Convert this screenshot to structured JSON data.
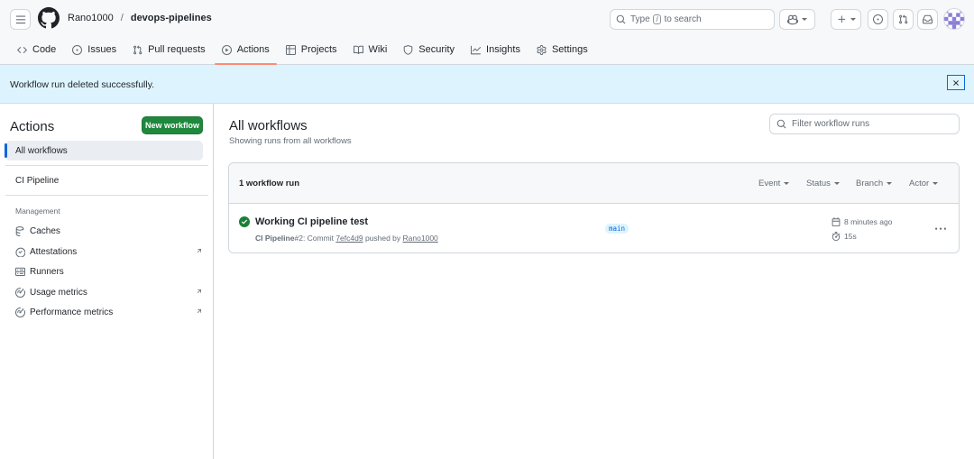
{
  "header": {
    "owner": "Rano1000",
    "separator": "/",
    "repo": "devops-pipelines",
    "search": {
      "prefix": "Type",
      "key": "/",
      "suffix": "to search"
    }
  },
  "tabs": [
    {
      "label": "Code",
      "icon": "code-icon"
    },
    {
      "label": "Issues",
      "icon": "issue-opened-icon"
    },
    {
      "label": "Pull requests",
      "icon": "git-pull-request-icon"
    },
    {
      "label": "Actions",
      "icon": "play-icon",
      "active": true
    },
    {
      "label": "Projects",
      "icon": "table-icon"
    },
    {
      "label": "Wiki",
      "icon": "book-icon"
    },
    {
      "label": "Security",
      "icon": "shield-icon"
    },
    {
      "label": "Insights",
      "icon": "graph-icon"
    },
    {
      "label": "Settings",
      "icon": "gear-icon"
    }
  ],
  "flash": {
    "message": "Workflow run deleted successfully."
  },
  "sidebar": {
    "title": "Actions",
    "new_workflow": "New workflow",
    "all_workflows": "All workflows",
    "workflows": [
      "CI Pipeline"
    ],
    "management_heading": "Management",
    "management": [
      {
        "label": "Caches",
        "icon": "cache-icon"
      },
      {
        "label": "Attestations",
        "icon": "verified-icon"
      },
      {
        "label": "Runners",
        "icon": "server-icon"
      },
      {
        "label": "Usage metrics",
        "icon": "meter-icon"
      },
      {
        "label": "Performance metrics",
        "icon": "meter-icon"
      }
    ]
  },
  "main": {
    "title": "All workflows",
    "subtitle": "Showing runs from all workflows",
    "filter_placeholder": "Filter workflow runs",
    "runs_count": "1 workflow run",
    "filters": [
      "Event",
      "Status",
      "Branch",
      "Actor"
    ],
    "run": {
      "title": "Working CI pipeline test",
      "workflow": "CI Pipeline",
      "run_number": "#2",
      "commit_text": ": Commit",
      "sha": "7efc4d9",
      "pushed_by": "pushed by",
      "actor": "Rano1000",
      "branch": "main",
      "when": "8 minutes ago",
      "duration": "15s",
      "status_color": "#1a7f37"
    }
  },
  "colors": {
    "accent": "#0969da",
    "primary_button": "#1f883d",
    "flash_bg": "#ddf4ff",
    "tab_underline": "#fd8c73"
  }
}
